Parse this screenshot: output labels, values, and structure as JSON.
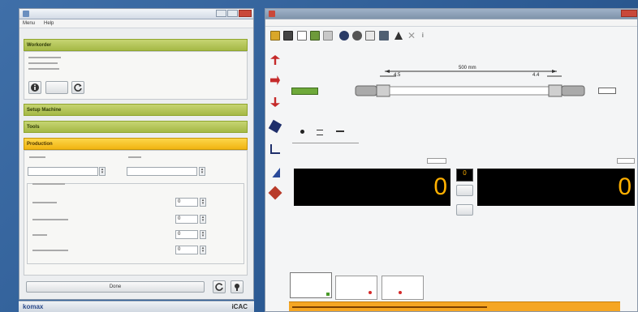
{
  "left_window": {
    "menu": [
      "Menu",
      "Help"
    ],
    "sections": {
      "workorder": "Workorder",
      "setup_machine": "Setup Machine",
      "tools": "Tools",
      "production": "Production"
    },
    "scrap_rows": [
      {
        "unit_value": "0"
      },
      {
        "unit_value": "0"
      },
      {
        "unit_value": "0"
      },
      {
        "unit_value": "0"
      }
    ],
    "done_button": "Done"
  },
  "right_window": {
    "dimension_label": "500 mm",
    "left_strip": "4.5",
    "right_strip": "4.4",
    "left_counter_value": "0",
    "right_counter_value": "0",
    "mini_counter_value": "0"
  },
  "taskbar": {
    "brand": "komax",
    "brand_right": "iCAC"
  },
  "colors": {
    "accent_green": "#b0c45a",
    "accent_yellow": "#f6c21f",
    "counter_digit": "#ffb000",
    "desktop": "#2f5f99"
  }
}
